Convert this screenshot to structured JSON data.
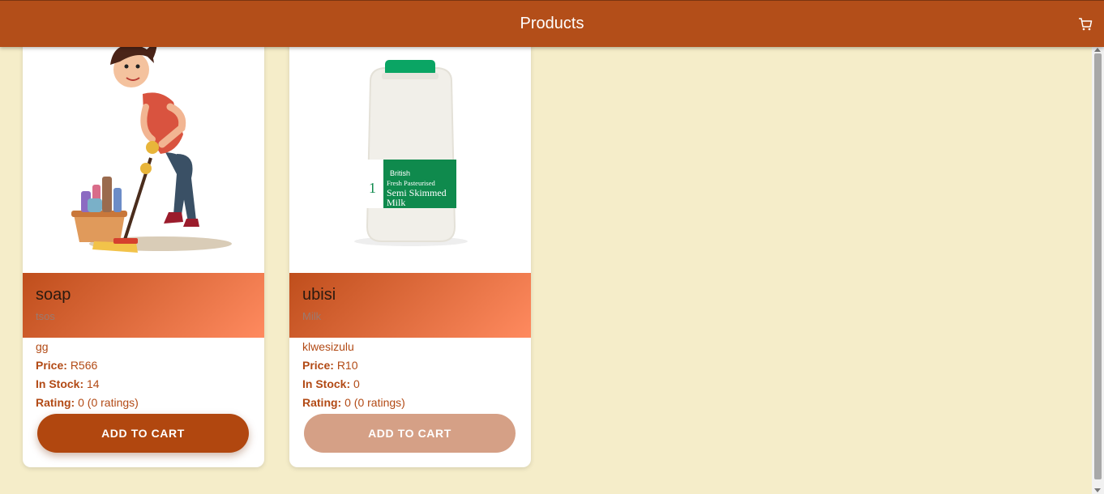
{
  "appbar": {
    "title": "Products",
    "cart_icon": "cart-icon"
  },
  "products": [
    {
      "name": "soap",
      "category": "tsos",
      "description": "gg",
      "price_label": "Price:",
      "price": "R566",
      "stock_label": "In Stock:",
      "stock": "14",
      "rating_label": "Rating:",
      "rating": "0 (0 ratings)",
      "button": "ADD TO CART",
      "image": "cleaning-woman-illustration"
    },
    {
      "name": "ubisi",
      "category": "Milk",
      "description": "klwesizulu",
      "price_label": "Price:",
      "price": "R10",
      "stock_label": "In Stock:",
      "stock": "0",
      "rating_label": "Rating:",
      "rating": "0 (0 ratings)",
      "button": "ADD TO CART",
      "image": "milk-bottle-photo",
      "label_brand": "British",
      "label_line1": "Fresh Pasteurised",
      "label_line2": "Semi Skimmed",
      "label_line3": "Milk",
      "label_size": "1"
    }
  ],
  "colors": {
    "accent": "#b34e19",
    "background": "#f5edc9",
    "button_disabled": "#d5a086"
  }
}
